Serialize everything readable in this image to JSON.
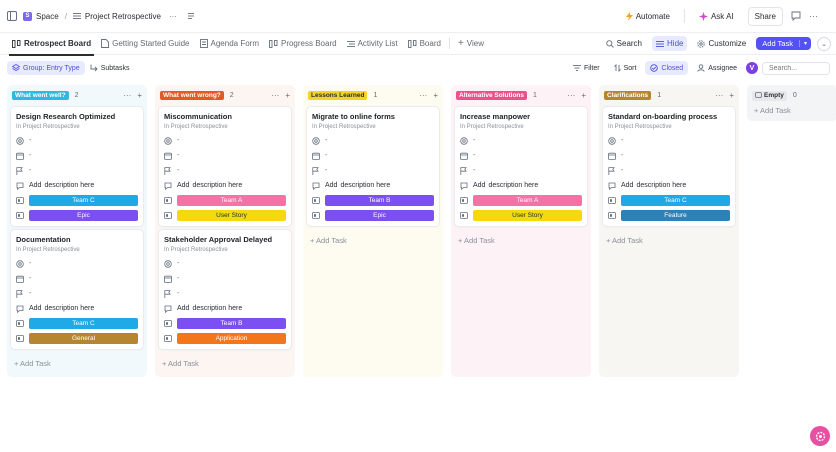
{
  "breadcrumb": {
    "space": "Space",
    "space_badge": "S",
    "separator": "/",
    "list": "Project Retrospective",
    "more": "···"
  },
  "topbar": {
    "automate": "Automate",
    "ask_ai": "Ask AI",
    "share": "Share"
  },
  "tabs": [
    {
      "label": "Retrospect Board",
      "icon": "board-icon",
      "active": true
    },
    {
      "label": "Getting Started Guide",
      "icon": "doc-icon",
      "active": false
    },
    {
      "label": "Agenda Form",
      "icon": "form-icon",
      "active": false
    },
    {
      "label": "Progress Board",
      "icon": "board-icon",
      "active": false
    },
    {
      "label": "Activity List",
      "icon": "list-icon",
      "active": false
    },
    {
      "label": "Board",
      "icon": "board-icon",
      "active": false
    },
    {
      "label": "View",
      "icon": "plus-icon",
      "active": false
    }
  ],
  "tabs_right": {
    "search": "Search",
    "hide": "Hide",
    "customize": "Customize",
    "add_task": "Add Task"
  },
  "filterbar": {
    "group": "Group: Entry Type",
    "subtasks": "Subtasks",
    "filter": "Filter",
    "sort": "Sort",
    "closed": "Closed",
    "assignee": "Assignee",
    "avatar": "V",
    "search_placeholder": "Search..."
  },
  "card_labels": {
    "sub": "In Project Retrospective",
    "dash": "-",
    "add": "Add",
    "description": "description here",
    "add_task": "+ Add Task"
  },
  "columns": [
    {
      "name": "What went well?",
      "count": "2",
      "color": "#2fb8e4",
      "bg": "#f2f9fd",
      "cards": [
        {
          "title": "Design Research Optimized",
          "team": "Team C",
          "team_color": "#1fa9e6",
          "type": "Epic",
          "type_color": "#7c4ff3"
        },
        {
          "title": "Documentation",
          "team": "Team C",
          "team_color": "#1fa9e6",
          "type": "General",
          "type_color": "#b5862f"
        }
      ]
    },
    {
      "name": "What went wrong?",
      "count": "2",
      "color": "#e35b23",
      "bg": "#fdf5f1",
      "cards": [
        {
          "title": "Miscommunication",
          "team": "Team A",
          "team_color": "#f373a6",
          "type": "User Story",
          "type_color": "#f5d90e",
          "type_text": "#2a2e34"
        },
        {
          "title": "Stakeholder Approval Delayed",
          "team": "Team B",
          "team_color": "#7c4ff3",
          "type": "Application",
          "type_color": "#f2761c"
        }
      ]
    },
    {
      "name": "Lessons Learned",
      "count": "1",
      "color": "#f5d22a",
      "bg": "#fefcf1",
      "tag_text": "#2a2e34",
      "cards": [
        {
          "title": "Migrate to online forms",
          "team": "Team B",
          "team_color": "#7c4ff3",
          "type": "Epic",
          "type_color": "#7c4ff3"
        }
      ]
    },
    {
      "name": "Alternative Solutions",
      "count": "1",
      "color": "#f0508a",
      "bg": "#fdf3f7",
      "cards": [
        {
          "title": "Increase manpower",
          "team": "Team A",
          "team_color": "#f373a6",
          "type": "User Story",
          "type_color": "#f5d90e",
          "type_text": "#2a2e34"
        }
      ]
    },
    {
      "name": "Clarifications",
      "count": "1",
      "color": "#b5862f",
      "bg": "#f8f6f2",
      "cards": [
        {
          "title": "Standard on-boarding process",
          "team": "Team C",
          "team_color": "#1fa9e6",
          "type": "Feature",
          "type_color": "#2f80b5"
        }
      ]
    }
  ],
  "empty_column": {
    "name": "Empty",
    "count": "0"
  }
}
